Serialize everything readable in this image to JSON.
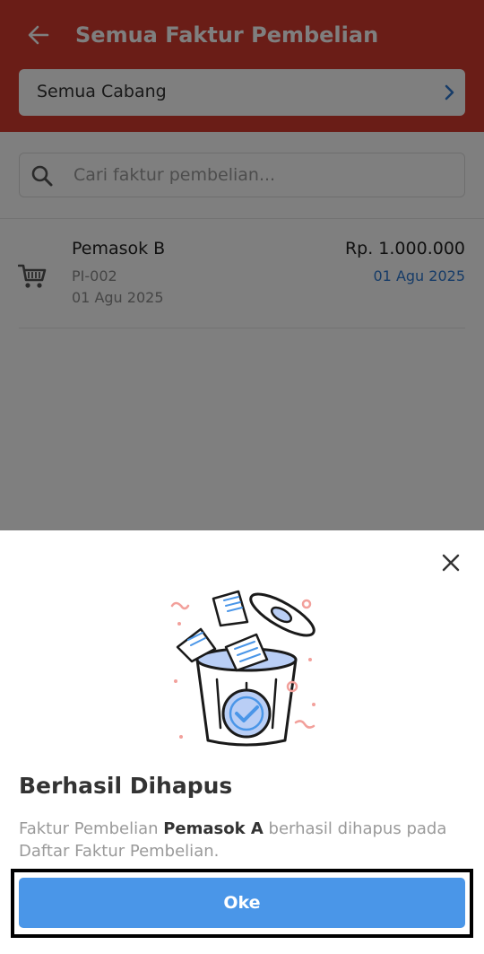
{
  "header": {
    "title": "Semua Faktur Pembelian",
    "back_icon": "arrow-left-icon",
    "branch_selector": {
      "value": "Semua Cabang",
      "icon": "chevron-right-icon"
    }
  },
  "search": {
    "placeholder": "Cari faktur pembelian...",
    "value": "",
    "icon": "search-icon"
  },
  "invoices": [
    {
      "icon": "shopping-cart-icon",
      "supplier": "Pemasok B",
      "number": "PI-002",
      "date": "01 Agu 2025",
      "amount": "Rp. 1.000.000",
      "due_date": "01 Agu 2025"
    }
  ],
  "dialog": {
    "close_icon": "close-icon",
    "illustration": "trash-bin-illustration",
    "title": "Berhasil Dihapus",
    "message_prefix": "Faktur Pembelian ",
    "message_bold": "Pemasok A",
    "message_suffix": " berhasil dihapus pada Daftar Faktur Pembelian.",
    "ok_label": "Oke"
  },
  "colors": {
    "header_bg": "#d43a2e",
    "primary_button": "#4a96e8",
    "due_date_text": "#2f79d1"
  }
}
